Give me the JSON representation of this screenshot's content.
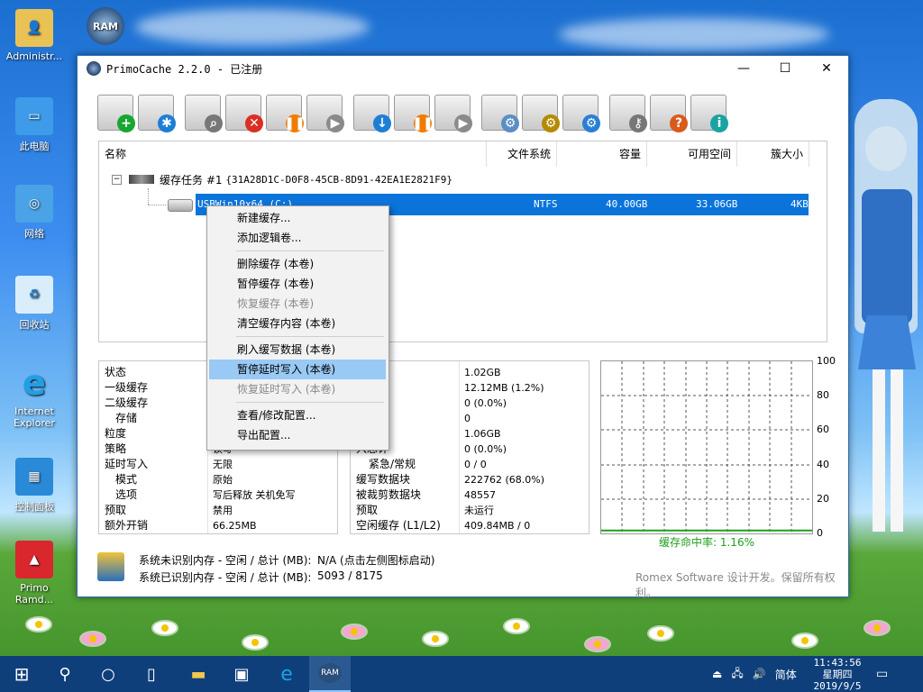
{
  "desktop": {
    "icons": [
      {
        "label": "Administr..."
      },
      {
        "label": "此电脑"
      },
      {
        "label": "网络"
      },
      {
        "label": "回收站"
      },
      {
        "label": "Internet Explorer"
      },
      {
        "label": "控制面板"
      },
      {
        "label": "Primo Ramd..."
      }
    ],
    "ram_shortcut_text": "RAM"
  },
  "window": {
    "title": "PrimoCache 2.2.0 - 已注册",
    "controls": {
      "minimize": "—",
      "maximize": "☐",
      "close": "✕"
    }
  },
  "toolbar": {
    "buttons": [
      {
        "name": "new-cache",
        "badge": "+",
        "color": "#19a531"
      },
      {
        "name": "add-volume",
        "badge": "✱",
        "color": "#1d7ed6"
      },
      {
        "name": "view-cache",
        "badge": "⌕",
        "color": "#777777"
      },
      {
        "name": "delete-cache",
        "badge": "✕",
        "color": "#d93025"
      },
      {
        "name": "pause-cache",
        "badge": "❚❚",
        "color": "#ef7c00"
      },
      {
        "name": "resume-cache",
        "badge": "▶",
        "color": "#8a8a8a"
      },
      {
        "name": "flush-deferred",
        "badge": "↓",
        "color": "#1d7ed6"
      },
      {
        "name": "pause-deferred",
        "badge": "❚❚",
        "color": "#ef7c00"
      },
      {
        "name": "resume-deferred",
        "badge": "▶",
        "color": "#8a8a8a"
      },
      {
        "name": "settings",
        "badge": "⚙",
        "color": "#5a8ec4"
      },
      {
        "name": "hardware",
        "badge": "⚙",
        "color": "#b58900"
      },
      {
        "name": "options",
        "badge": "⚙",
        "color": "#2a7fd4"
      },
      {
        "name": "license",
        "badge": "⚷",
        "color": "#777777"
      },
      {
        "name": "help",
        "badge": "?",
        "color": "#d95a1a"
      },
      {
        "name": "about",
        "badge": "i",
        "color": "#1aa3a3"
      }
    ]
  },
  "list": {
    "headers": [
      "名称",
      "文件系统",
      "容量",
      "可用空间",
      "簇大小"
    ],
    "task": {
      "label": "缓存任务 #1",
      "id": "{31A28D1C-D0F8-45CB-8D91-42EA1E2821F9}"
    },
    "volume": {
      "name": "USBWin10x64 (C:)",
      "fs": "NTFS",
      "capacity": "40.00GB",
      "free": "33.06GB",
      "cluster": "4KB"
    }
  },
  "context_menu": {
    "items": [
      {
        "label": "新建缓存...",
        "enabled": true
      },
      {
        "label": "添加逻辑卷...",
        "enabled": true
      },
      {
        "label": "删除缓存 (本卷)",
        "enabled": true
      },
      {
        "label": "暂停缓存 (本卷)",
        "enabled": true
      },
      {
        "label": "恢复缓存 (本卷)",
        "enabled": false
      },
      {
        "label": "清空缓存内容 (本卷)",
        "enabled": true
      },
      {
        "label": "刷入缓写数据 (本卷)",
        "enabled": true
      },
      {
        "label": "暂停延时写入 (本卷)",
        "enabled": true,
        "highlighted": true
      },
      {
        "label": "恢复延时写入 (本卷)",
        "enabled": false
      },
      {
        "label": "查看/修改配置...",
        "enabled": true
      },
      {
        "label": "导出配置...",
        "enabled": true
      }
    ]
  },
  "left_panel": {
    "labels": [
      "状态",
      "一级缓存",
      "二级缓存",
      "存储",
      "粒度",
      "策略",
      "延时写入",
      "模式",
      "选项",
      "预取",
      "额外开销"
    ],
    "values": [
      "",
      "",
      "",
      "",
      "",
      "读写",
      "无限",
      "原始",
      "写后释放 关机免写",
      "禁用",
      "66.25MB"
    ]
  },
  "middle_panel": {
    "labels": [
      "计",
      "存",
      "级缓存",
      "级缓存",
      "入总计",
      "入总计",
      "紧急/常规",
      "缓写数据块",
      "被裁剪数据块",
      "预取",
      "空闲缓存 (L1/L2)"
    ],
    "values": [
      "1.02GB",
      "12.12MB (1.2%)",
      "0 (0.0%)",
      "0",
      "1.06GB",
      "0 (0.0%)",
      "0 / 0",
      "222762 (68.0%)",
      "48557",
      "未运行",
      "409.84MB / 0"
    ]
  },
  "graph": {
    "y_ticks": [
      "100",
      "80",
      "60",
      "40",
      "20",
      "0"
    ],
    "caption": "缓存命中率: 1.16%",
    "hit_rate_percent": 1.16,
    "line_color": "#1ea01e"
  },
  "footer": {
    "row1_label": "系统未识别内存 - 空闲 / 总计 (MB):",
    "row1_value": "N/A (点击左侧图标启动)",
    "row2_label": "系统已识别内存 - 空闲 / 总计 (MB):",
    "row2_value": "5093 / 8175",
    "copyright": "Romex Software 设计开发。保留所有权利。"
  },
  "taskbar": {
    "ime": "简体",
    "time": "11:43:56",
    "weekday": "星期四",
    "date": "2019/9/5",
    "ram_label": "RAM"
  }
}
